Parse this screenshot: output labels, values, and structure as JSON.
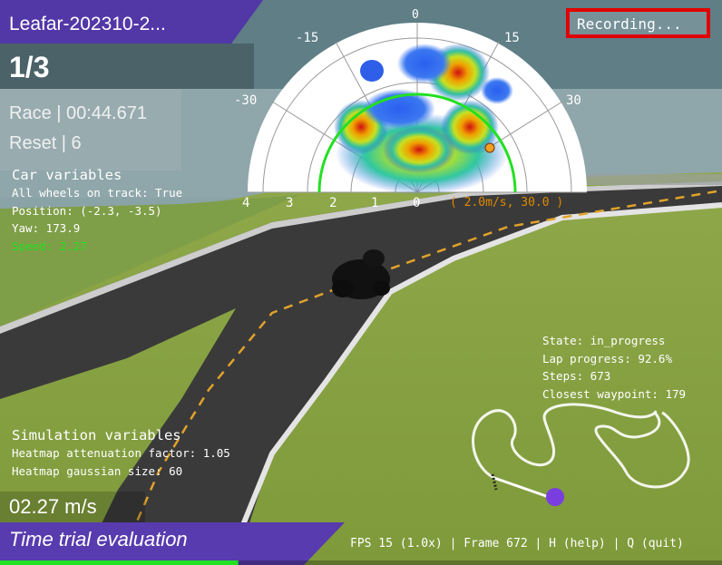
{
  "header": {
    "model_name": "Leafar-202310-2...",
    "lap_counter": "1/3",
    "race_label": "Race | 00:44.671",
    "reset_label": "Reset | 6",
    "recording_label": "Recording..."
  },
  "car_variables": {
    "title": "Car variables",
    "all_wheels": "All wheels on track: True",
    "position": "Position: (-2.3, -3.5)",
    "yaw": "Yaw: 173.9",
    "speed": "Speed: 2.27"
  },
  "polar_chart": {
    "angle_labels": [
      "0",
      "-15",
      "15",
      "-30",
      "30"
    ],
    "radius_labels": [
      "4",
      "3",
      "2",
      "1",
      "0"
    ],
    "action_label": "( 2.0m/s, 30.0 )"
  },
  "state_panel": {
    "state": "State: in_progress",
    "lap_progress": "Lap progress: 92.6%",
    "steps": "Steps: 673",
    "closest_waypoint": "Closest waypoint: 179"
  },
  "simulation_variables": {
    "title": "Simulation variables",
    "attenuation": "Heatmap attenuation factor: 1.05",
    "gaussian": "Heatmap gaussian size: 60"
  },
  "footer": {
    "speed_readout": "02.27 m/s",
    "mode_label": "Time trial evaluation",
    "status_bar": "FPS 15 (1.0x) | Frame 672 | H (help) | Q (quit)",
    "progress_fraction": 0.33
  },
  "colors": {
    "accent_purple": "#5b3fb8",
    "recording_red": "#e00000",
    "speed_green": "#22e022",
    "action_orange": "#e08a00"
  }
}
